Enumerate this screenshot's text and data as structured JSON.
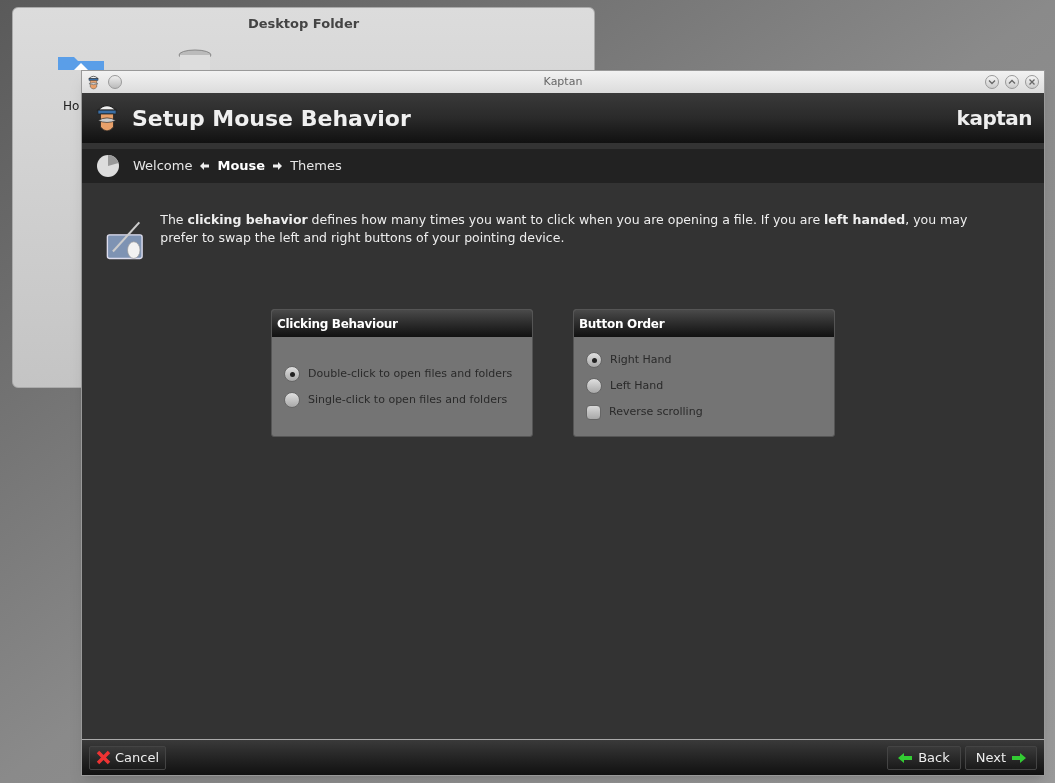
{
  "desktop_folder": {
    "title": "Desktop Folder",
    "home_label": "Ho"
  },
  "window": {
    "title": "Kaptan",
    "heading": "Setup Mouse Behavior",
    "brand": "kaptan"
  },
  "steps": [
    {
      "label": "Welcome",
      "selected": false
    },
    {
      "label": "Mouse",
      "selected": true
    },
    {
      "label": "Themes",
      "selected": false
    }
  ],
  "intro": "The **clicking behavior** defines how many times you want to click when you are opening a file. If you are **left handed**, you may prefer to swap the left and right buttons of your pointing device.",
  "groups": [
    {
      "title": "Clicking Behaviour",
      "options": [
        {
          "kind": "radio",
          "label": "Double-click to open files and folders",
          "selected": true
        },
        {
          "kind": "radio",
          "label": "Single-click to open files and folders",
          "selected": false
        }
      ]
    },
    {
      "title": "Button Order",
      "options": [
        {
          "kind": "radio",
          "label": "Right Hand",
          "selected": true
        },
        {
          "kind": "radio",
          "label": "Left Hand",
          "selected": false
        },
        {
          "kind": "checkbox",
          "label": "Reverse scrolling",
          "checked": false
        }
      ]
    }
  ],
  "buttons": {
    "cancel": "Cancel",
    "back": "Back",
    "next": "Next"
  }
}
